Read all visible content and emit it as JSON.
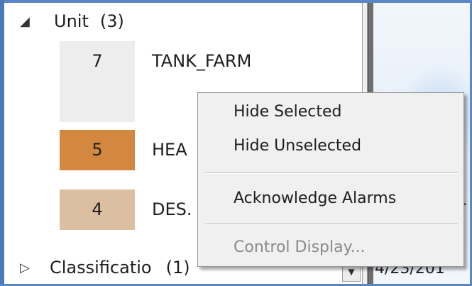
{
  "tree": {
    "unit_group": {
      "caret": "◢",
      "label": "Unit",
      "count": "(3)"
    },
    "units": [
      {
        "number": "7",
        "name": "TANK_FARM",
        "color": "#ededed",
        "text_color": "#1e1e1e"
      },
      {
        "number": "5",
        "name": "HEA",
        "color": "#d4873f",
        "text_color": "#1e1e1e"
      },
      {
        "number": "4",
        "name": "DES.",
        "color": "#dcbfa1",
        "text_color": "#1e1e1e"
      }
    ],
    "classification_group": {
      "caret": "▷",
      "label": "Classificatio",
      "count": "(1)"
    }
  },
  "right_panel": {
    "date_text": "4/23/201",
    "edge_glyph": "·"
  },
  "context_menu": {
    "items": [
      {
        "label": "Hide Selected",
        "enabled": true
      },
      {
        "label": "Hide Unselected",
        "enabled": true
      },
      {
        "label": "Acknowledge Alarms",
        "enabled": true
      },
      {
        "label": "Control Display...",
        "enabled": false
      }
    ]
  },
  "colors": {
    "window_border": "#5a86c3",
    "menu_background": "#f0f0f0",
    "unit_5_color": "#d4873f",
    "unit_4_color": "#dcbfa1"
  },
  "icons": {
    "expanded_caret": "triangle-down-icon",
    "collapsed_caret": "triangle-right-icon",
    "dropdown": "chevron-down-icon"
  }
}
